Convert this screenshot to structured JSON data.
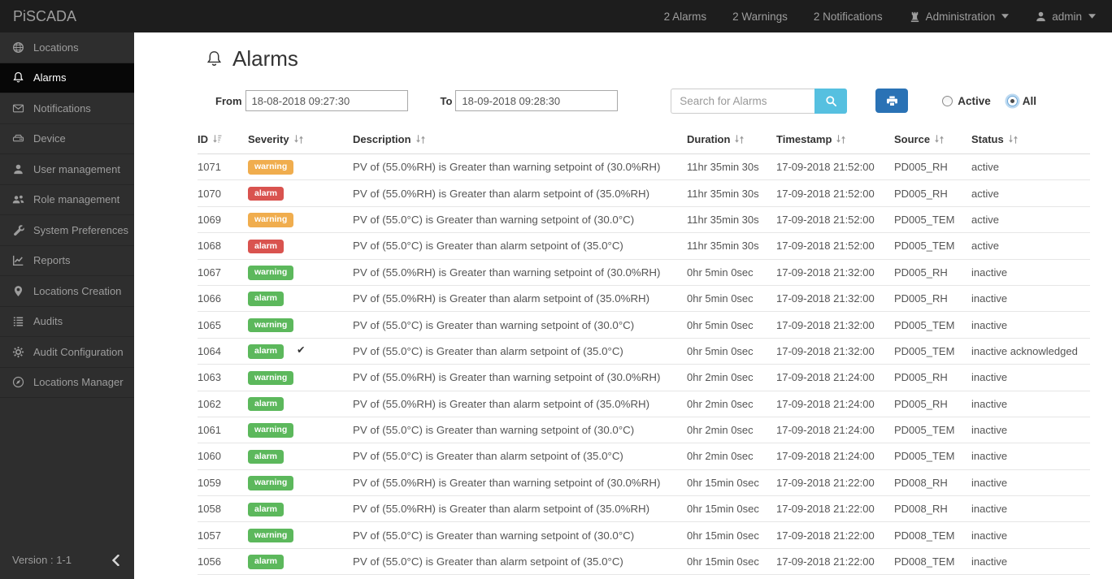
{
  "navbar": {
    "brand": "PiSCADA",
    "alarms_summary": "2 Alarms",
    "warnings_summary": "2 Warnings",
    "notifications_summary": "2 Notifications",
    "administration_label": "Administration",
    "user_label": "admin"
  },
  "sidebar": {
    "items": [
      {
        "label": "Locations",
        "icon": "globe-icon",
        "active": false
      },
      {
        "label": "Alarms",
        "icon": "bell-icon",
        "active": true
      },
      {
        "label": "Notifications",
        "icon": "envelope-icon",
        "active": false
      },
      {
        "label": "Device",
        "icon": "hdd-icon",
        "active": false
      },
      {
        "label": "User management",
        "icon": "user-icon",
        "active": false
      },
      {
        "label": "Role management",
        "icon": "users-icon",
        "active": false
      },
      {
        "label": "System Preferences",
        "icon": "wrench-icon",
        "active": false
      },
      {
        "label": "Reports",
        "icon": "chart-icon",
        "active": false
      },
      {
        "label": "Locations Creation",
        "icon": "map-marker-icon",
        "active": false
      },
      {
        "label": "Audits",
        "icon": "list-icon",
        "active": false
      },
      {
        "label": "Audit Configuration",
        "icon": "gear-icon",
        "active": false
      },
      {
        "label": "Locations Manager",
        "icon": "compass-icon",
        "active": false
      }
    ],
    "version": "Version : 1-1"
  },
  "main": {
    "title": "Alarms",
    "filters": {
      "from_label": "From",
      "from_value": "18-08-2018 09:27:30",
      "to_label": "To",
      "to_value": "18-09-2018 09:28:30",
      "search_placeholder": "Search for Alarms",
      "active_label": "Active",
      "all_label": "All",
      "selected_filter": "All"
    },
    "table": {
      "columns": [
        {
          "label": "ID",
          "sort_icon": "sort-amount-desc"
        },
        {
          "label": "Severity",
          "sort_icon": "sort-updown"
        },
        {
          "label": "Description",
          "sort_icon": "sort-updown"
        },
        {
          "label": "Duration",
          "sort_icon": "sort-updown"
        },
        {
          "label": "Timestamp",
          "sort_icon": "sort-updown"
        },
        {
          "label": "Source",
          "sort_icon": "sort-updown"
        },
        {
          "label": "Status",
          "sort_icon": "sort-updown"
        }
      ],
      "rows": [
        {
          "id": "1071",
          "severity": "warning",
          "severity_color": "#f0ad4e",
          "acknowledged": false,
          "description": "PV of (55.0%RH) is Greater than warning setpoint of (30.0%RH)",
          "duration": "11hr 35min 30s",
          "timestamp": "17-09-2018 21:52:00",
          "source": "PD005_RH",
          "status": "active"
        },
        {
          "id": "1070",
          "severity": "alarm",
          "severity_color": "#d9534f",
          "acknowledged": false,
          "description": "PV of (55.0%RH) is Greater than alarm setpoint of (35.0%RH)",
          "duration": "11hr 35min 30s",
          "timestamp": "17-09-2018 21:52:00",
          "source": "PD005_RH",
          "status": "active"
        },
        {
          "id": "1069",
          "severity": "warning",
          "severity_color": "#f0ad4e",
          "acknowledged": false,
          "description": "PV of (55.0°C) is Greater than warning setpoint of (30.0°C)",
          "duration": "11hr 35min 30s",
          "timestamp": "17-09-2018 21:52:00",
          "source": "PD005_TEM",
          "status": "active"
        },
        {
          "id": "1068",
          "severity": "alarm",
          "severity_color": "#d9534f",
          "acknowledged": false,
          "description": "PV of (55.0°C) is Greater than alarm setpoint of (35.0°C)",
          "duration": "11hr 35min 30s",
          "timestamp": "17-09-2018 21:52:00",
          "source": "PD005_TEM",
          "status": "active"
        },
        {
          "id": "1067",
          "severity": "warning",
          "severity_color": "#5cb85c",
          "acknowledged": false,
          "description": "PV of (55.0%RH) is Greater than warning setpoint of (30.0%RH)",
          "duration": "0hr 5min 0sec",
          "timestamp": "17-09-2018 21:32:00",
          "source": "PD005_RH",
          "status": "inactive"
        },
        {
          "id": "1066",
          "severity": "alarm",
          "severity_color": "#5cb85c",
          "acknowledged": false,
          "description": "PV of (55.0%RH) is Greater than alarm setpoint of (35.0%RH)",
          "duration": "0hr 5min 0sec",
          "timestamp": "17-09-2018 21:32:00",
          "source": "PD005_RH",
          "status": "inactive"
        },
        {
          "id": "1065",
          "severity": "warning",
          "severity_color": "#5cb85c",
          "acknowledged": false,
          "description": "PV of (55.0°C) is Greater than warning setpoint of (30.0°C)",
          "duration": "0hr 5min 0sec",
          "timestamp": "17-09-2018 21:32:00",
          "source": "PD005_TEM",
          "status": "inactive"
        },
        {
          "id": "1064",
          "severity": "alarm",
          "severity_color": "#5cb85c",
          "acknowledged": true,
          "description": "PV of (55.0°C) is Greater than alarm setpoint of (35.0°C)",
          "duration": "0hr 5min 0sec",
          "timestamp": "17-09-2018 21:32:00",
          "source": "PD005_TEM",
          "status": "inactive acknowledged"
        },
        {
          "id": "1063",
          "severity": "warning",
          "severity_color": "#5cb85c",
          "acknowledged": false,
          "description": "PV of (55.0%RH) is Greater than warning setpoint of (30.0%RH)",
          "duration": "0hr 2min 0sec",
          "timestamp": "17-09-2018 21:24:00",
          "source": "PD005_RH",
          "status": "inactive"
        },
        {
          "id": "1062",
          "severity": "alarm",
          "severity_color": "#5cb85c",
          "acknowledged": false,
          "description": "PV of (55.0%RH) is Greater than alarm setpoint of (35.0%RH)",
          "duration": "0hr 2min 0sec",
          "timestamp": "17-09-2018 21:24:00",
          "source": "PD005_RH",
          "status": "inactive"
        },
        {
          "id": "1061",
          "severity": "warning",
          "severity_color": "#5cb85c",
          "acknowledged": false,
          "description": "PV of (55.0°C) is Greater than warning setpoint of (30.0°C)",
          "duration": "0hr 2min 0sec",
          "timestamp": "17-09-2018 21:24:00",
          "source": "PD005_TEM",
          "status": "inactive"
        },
        {
          "id": "1060",
          "severity": "alarm",
          "severity_color": "#5cb85c",
          "acknowledged": false,
          "description": "PV of (55.0°C) is Greater than alarm setpoint of (35.0°C)",
          "duration": "0hr 2min 0sec",
          "timestamp": "17-09-2018 21:24:00",
          "source": "PD005_TEM",
          "status": "inactive"
        },
        {
          "id": "1059",
          "severity": "warning",
          "severity_color": "#5cb85c",
          "acknowledged": false,
          "description": "PV of (55.0%RH) is Greater than warning setpoint of (30.0%RH)",
          "duration": "0hr 15min 0sec",
          "timestamp": "17-09-2018 21:22:00",
          "source": "PD008_RH",
          "status": "inactive"
        },
        {
          "id": "1058",
          "severity": "alarm",
          "severity_color": "#5cb85c",
          "acknowledged": false,
          "description": "PV of (55.0%RH) is Greater than alarm setpoint of (35.0%RH)",
          "duration": "0hr 15min 0sec",
          "timestamp": "17-09-2018 21:22:00",
          "source": "PD008_RH",
          "status": "inactive"
        },
        {
          "id": "1057",
          "severity": "warning",
          "severity_color": "#5cb85c",
          "acknowledged": false,
          "description": "PV of (55.0°C) is Greater than warning setpoint of (30.0°C)",
          "duration": "0hr 15min 0sec",
          "timestamp": "17-09-2018 21:22:00",
          "source": "PD008_TEM",
          "status": "inactive"
        },
        {
          "id": "1056",
          "severity": "alarm",
          "severity_color": "#5cb85c",
          "acknowledged": false,
          "description": "PV of (55.0°C) is Greater than alarm setpoint of (35.0°C)",
          "duration": "0hr 15min 0sec",
          "timestamp": "17-09-2018 21:22:00",
          "source": "PD008_TEM",
          "status": "inactive"
        }
      ]
    }
  },
  "colors": {
    "navbar_bg": "#1d1d1d",
    "sidebar_bg": "#2e2e2e",
    "active_item_bg": "#070707",
    "search_btn": "#56c0e0",
    "print_btn": "#2a72b5",
    "severity_warning_active": "#f0ad4e",
    "severity_alarm_active": "#d9534f",
    "severity_inactive": "#5cb85c"
  }
}
